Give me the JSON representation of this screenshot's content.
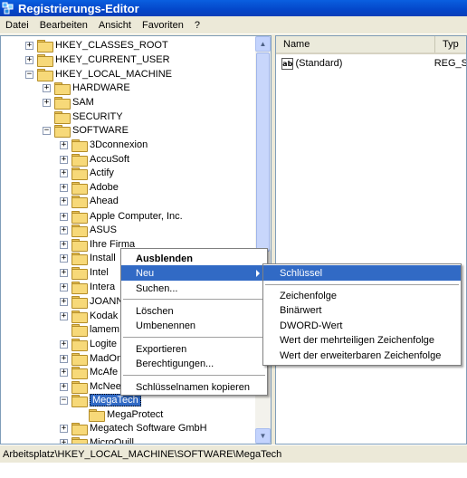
{
  "window": {
    "title": "Registrierungs-Editor"
  },
  "menubar": {
    "items": [
      "Datei",
      "Bearbeiten",
      "Ansicht",
      "Favoriten",
      "?"
    ]
  },
  "tree": {
    "roots": [
      "HKEY_CLASSES_ROOT",
      "HKEY_CURRENT_USER",
      "HKEY_LOCAL_MACHINE"
    ],
    "hklm": [
      "HARDWARE",
      "SAM",
      "SECURITY",
      "SOFTWARE"
    ],
    "software": [
      "3Dconnexion",
      "AccuSoft",
      "Actify",
      "Adobe",
      "Ahead",
      "Apple Computer, Inc.",
      "ASUS",
      "Ihre Firma",
      "Install",
      "Intel",
      "Intera",
      "JOANN",
      "Kodak",
      "lamem",
      "Logite",
      "MadOn",
      "McAfe",
      "McNee",
      "MegaTech",
      "MegaProtect",
      "Megatech Software GmbH",
      "MicroQuill"
    ],
    "expander_plus": "+",
    "expander_minus": "−"
  },
  "list": {
    "columns": [
      "Name",
      "Typ"
    ],
    "rows": [
      {
        "name": "(Standard)",
        "type": "REG_S"
      }
    ],
    "icon_text": "ab"
  },
  "context_menu": {
    "items": [
      "Ausblenden",
      "Neu",
      "Suchen...",
      "Löschen",
      "Umbenennen",
      "Exportieren",
      "Berechtigungen...",
      "Schlüsselnamen kopieren"
    ]
  },
  "submenu": {
    "items": [
      "Schlüssel",
      "Zeichenfolge",
      "Binärwert",
      "DWORD-Wert",
      "Wert der mehrteiligen Zeichenfolge",
      "Wert der erweiterbaren Zeichenfolge"
    ]
  },
  "statusbar": {
    "path": "Arbeitsplatz\\HKEY_LOCAL_MACHINE\\SOFTWARE\\MegaTech"
  },
  "scrollbar": {
    "up_glyph": "▲",
    "down_glyph": "▼"
  },
  "colors": {
    "selection": "#316ac5",
    "title": "#0a5fe0"
  }
}
